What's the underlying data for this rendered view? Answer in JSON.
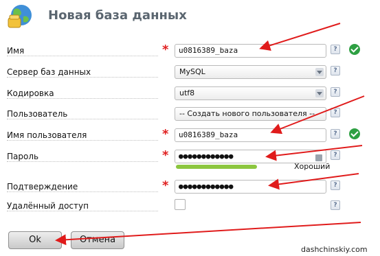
{
  "header": {
    "title": "Новая база данных",
    "icon": "globe-database-icon"
  },
  "form": {
    "name": {
      "label": "Имя",
      "value": "u0816389_baza",
      "required": true,
      "valid": true
    },
    "server": {
      "label": "Сервер баз данных",
      "value": "MySQL"
    },
    "encoding": {
      "label": "Кодировка",
      "value": "utf8"
    },
    "user": {
      "label": "Пользователь",
      "value": "-- Создать нового пользователя --"
    },
    "username": {
      "label": "Имя пользователя",
      "value": "u0816389_baza",
      "required": true,
      "valid": true
    },
    "password": {
      "label": "Пароль",
      "value": "●●●●●●●●●●●●",
      "required": true,
      "strength": "Хороший",
      "strength_level": 0.55
    },
    "confirm": {
      "label": "Подтверждение",
      "value": "●●●●●●●●●●●●",
      "required": true
    },
    "remote": {
      "label": "Удалённый доступ",
      "checked": false
    }
  },
  "help_symbol": "?",
  "required_symbol": "*",
  "buttons": {
    "ok": "Ok",
    "cancel": "Отмена"
  },
  "watermark": "dashchinskiy.com",
  "colors": {
    "arrow": "#e01b1b",
    "required": "#e02020",
    "valid": "#2ea043",
    "strength": "#8cc63f"
  }
}
